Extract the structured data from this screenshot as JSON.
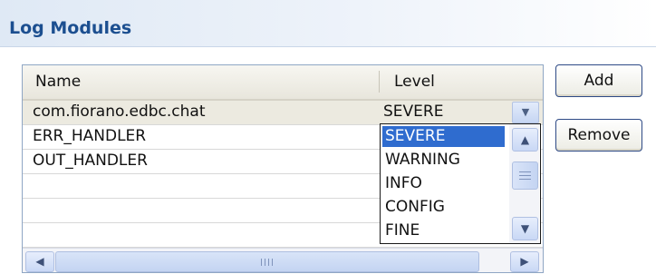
{
  "section": {
    "title": "Log Modules"
  },
  "table": {
    "columns": [
      "Name",
      "Level"
    ],
    "rows": [
      {
        "name": "com.fiorano.edbc.chat",
        "level": "SEVERE"
      },
      {
        "name": "ERR_HANDLER",
        "level": ""
      },
      {
        "name": "OUT_HANDLER",
        "level": ""
      },
      {
        "name": "",
        "level": ""
      },
      {
        "name": "",
        "level": ""
      },
      {
        "name": "",
        "level": ""
      }
    ]
  },
  "level_dropdown": {
    "selected": "SEVERE",
    "options": [
      "SEVERE",
      "WARNING",
      "INFO",
      "CONFIG",
      "FINE"
    ],
    "icons": {
      "open": "chevron-down-icon"
    }
  },
  "buttons": {
    "add": "Add",
    "remove": "Remove"
  },
  "scrollbar_icons": {
    "up": "arrow-up-icon",
    "down": "arrow-down-icon",
    "left": "arrow-left-icon",
    "right": "arrow-right-icon"
  },
  "colors": {
    "title": "#1c4f90",
    "highlight": "#2f6ccf",
    "border": "#2e4a86"
  }
}
